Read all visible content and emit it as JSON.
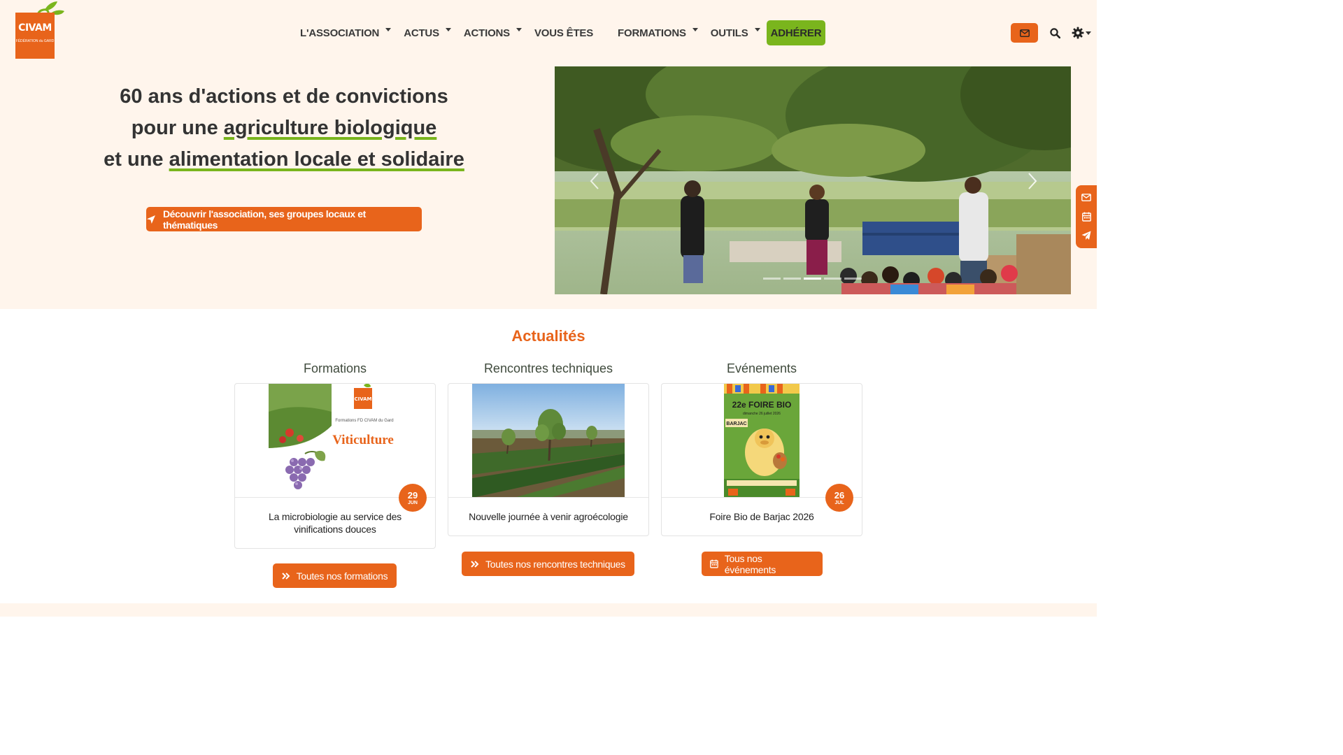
{
  "brand": {
    "name": "CIVAM",
    "subtitle": "FÉDÉRATION du GARD",
    "orange": "#e8641b",
    "green": "#7ab51d",
    "cream": "#fff5ec"
  },
  "nav": {
    "items": [
      {
        "label": "L'ASSOCIATION",
        "dropdown": true
      },
      {
        "label": "ACTUS",
        "dropdown": true
      },
      {
        "label": "ACTIONS",
        "dropdown": true
      },
      {
        "label": "VOUS ÊTES",
        "dropdown": false
      },
      {
        "label": "FORMATIONS",
        "dropdown": true
      },
      {
        "label": "OUTILS",
        "dropdown": true
      }
    ],
    "cta": "ADHÉRER"
  },
  "header_tools": {
    "mail_icon": "envelope-icon",
    "search_icon": "search-icon",
    "settings_icon": "gear-icon"
  },
  "hero": {
    "line1": "60 ans d'actions et de convictions",
    "line2_prefix": "pour une ",
    "line2_highlight": "agriculture biologique",
    "line3_prefix": "et une ",
    "line3_highlight": "alimentation locale et solidaire",
    "cta": "Découvrir l'association, ses groupes locaux et thématiques",
    "cta_icon": "location-arrow-icon"
  },
  "carousel": {
    "slides": 5,
    "active_slide": 3
  },
  "side_bar": {
    "icons": [
      "envelope-icon",
      "calendar-icon",
      "paper-plane-icon"
    ]
  },
  "news": {
    "title": "Actualités",
    "columns": [
      {
        "title": "Formations",
        "caption": "La microbiologie au service des vinifications douces",
        "date_day": "29",
        "date_month": "JUN",
        "thumb_heading": "Viticulture",
        "thumb_small": "Formations FD CIVAM du Gard",
        "thumb_logo": "CIVAM",
        "button": "Toutes nos formations",
        "button_icon": "double-chevron-right-icon"
      },
      {
        "title": "Rencontres techniques",
        "caption": "Nouvelle journée à venir agroécologie",
        "button": "Toutes nos rencontres techniques",
        "button_icon": "double-chevron-right-icon"
      },
      {
        "title": "Evénements",
        "caption": "Foire Bio de Barjac 2026",
        "date_day": "26",
        "date_month": "JUL",
        "thumb_heading": "22e FOIRE BIO",
        "thumb_small": "dimanche 26 juillet 2026",
        "thumb_place": "BARJAC",
        "button": "Tous nos événements",
        "button_icon": "calendar-icon"
      }
    ]
  }
}
